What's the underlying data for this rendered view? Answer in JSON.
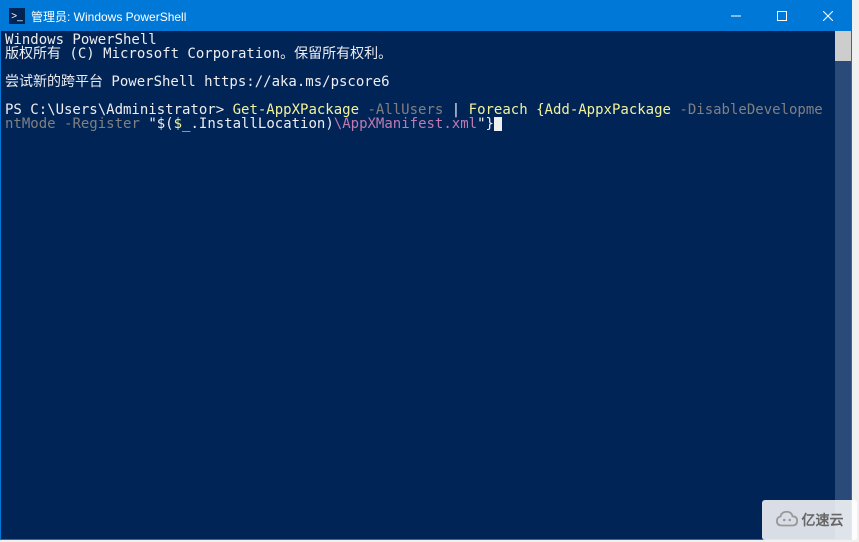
{
  "window": {
    "title": "管理员: Windows PowerShell",
    "icon_glyph": ">_"
  },
  "terminal": {
    "banner_line1": "Windows PowerShell",
    "banner_line2": "版权所有 (C) Microsoft Corporation。保留所有权利。",
    "banner_line3": "尝试新的跨平台 PowerShell https://aka.ms/pscore6",
    "prompt": "PS C:\\Users\\Administrator>",
    "command": {
      "cmdlet1": "Get-AppXPackage",
      "param_allusers": "-AllUsers",
      "pipe": "|",
      "foreach": "Foreach",
      "brace_open": "{",
      "cmdlet2": "Add-AppxPackage",
      "param_disable": "-DisableDevelopmentMode",
      "param_register": "-Register",
      "dquote": "\"",
      "dollar_open": "$(",
      "var": "$_",
      "dot": ".",
      "prop": "InstallLocation",
      "close_paren": ")",
      "path_literal": "\\AppXManifest.xml",
      "dquote2": "\"",
      "brace_close": "}"
    }
  },
  "watermark": {
    "text": "亿速云"
  }
}
